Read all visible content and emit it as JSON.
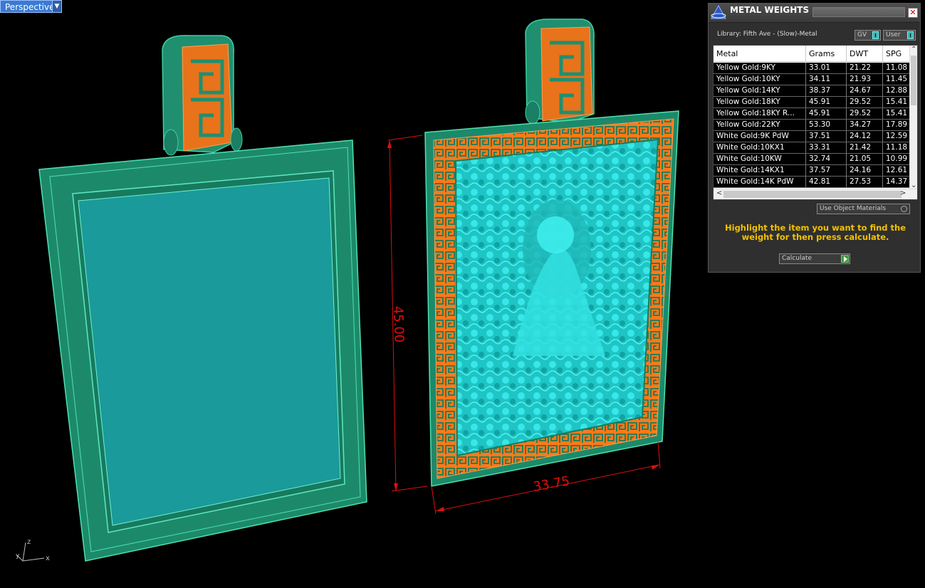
{
  "viewport": {
    "label": "Perspective",
    "dropdown_icon": "chevron-down-icon",
    "axis_labels": {
      "z": "z",
      "x": "x",
      "y": "y"
    },
    "dimensions": {
      "height": "45.00",
      "width": "33.75"
    },
    "colors": {
      "frame": "#1f8f70",
      "inner": "#1a9a9a",
      "relief": "#2be3e3",
      "border": "#ff7a1a",
      "dimension": "#e10e0e"
    }
  },
  "panel": {
    "title": "METAL WEIGHTS",
    "library": "Library: Fifth Ave - (Slow)-Metal",
    "toggles": [
      {
        "label": "GV"
      },
      {
        "label": "User"
      }
    ],
    "columns": [
      "Metal",
      "Grams",
      "DWT",
      "SPG"
    ],
    "rows": [
      {
        "metal": "Yellow Gold:9KY",
        "grams": "33.01",
        "dwt": "21.22",
        "spg": "11.08"
      },
      {
        "metal": "Yellow Gold:10KY",
        "grams": "34.11",
        "dwt": "21.93",
        "spg": "11.45"
      },
      {
        "metal": "Yellow Gold:14KY",
        "grams": "38.37",
        "dwt": "24.67",
        "spg": "12.88"
      },
      {
        "metal": "Yellow Gold:18KY",
        "grams": "45.91",
        "dwt": "29.52",
        "spg": "15.41"
      },
      {
        "metal": "Yellow Gold:18KY R...",
        "grams": "45.91",
        "dwt": "29.52",
        "spg": "15.41"
      },
      {
        "metal": "Yellow Gold:22KY",
        "grams": "53.30",
        "dwt": "34.27",
        "spg": "17.89"
      },
      {
        "metal": "White Gold:9K PdW",
        "grams": "37.51",
        "dwt": "24.12",
        "spg": "12.59"
      },
      {
        "metal": "White Gold:10KX1",
        "grams": "33.31",
        "dwt": "21.42",
        "spg": "11.18"
      },
      {
        "metal": "White Gold:10KW",
        "grams": "32.74",
        "dwt": "21.05",
        "spg": "10.99"
      },
      {
        "metal": "White Gold:14KX1",
        "grams": "37.57",
        "dwt": "24.16",
        "spg": "12.61"
      },
      {
        "metal": "White Gold:14K PdW",
        "grams": "42.81",
        "dwt": "27.53",
        "spg": "14.37"
      }
    ],
    "use_object_materials": "Use Object Materials",
    "instruction": "Highlight the item you want to find the weight for then press calculate.",
    "calculate_label": "Calculate"
  }
}
